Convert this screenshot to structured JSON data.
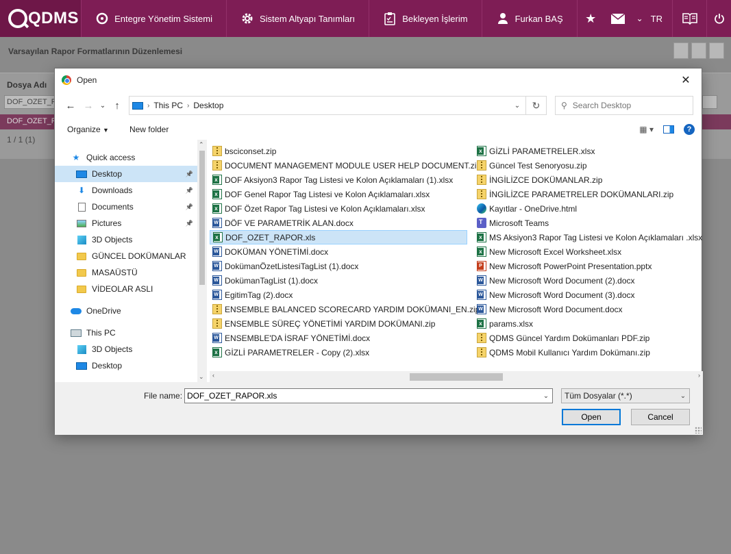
{
  "app": {
    "logo_text": "QDMS",
    "nav": [
      {
        "label": "Entegre Yönetim Sistemi",
        "icon": "q-circle-icon"
      },
      {
        "label": "Sistem Altyapı Tanımları",
        "icon": "gear-icon"
      },
      {
        "label": "Bekleyen İşlerim",
        "icon": "clipboard-icon"
      },
      {
        "label": "Furkan BAŞ",
        "icon": "user-icon"
      }
    ],
    "lang": "TR"
  },
  "background_page": {
    "title": "Varsayılan Rapor Formatlarının Düzenlemesi",
    "column_header": "Dosya Adı",
    "filter_value": "DOF_OZET_RA",
    "row_value": "DOF_OZET_RA",
    "pager": "1 / 1 (1)"
  },
  "dialog": {
    "title": "Open",
    "breadcrumb": [
      "This PC",
      "Desktop"
    ],
    "search_placeholder": "Search Desktop",
    "toolbar": {
      "organize": "Organize",
      "new_folder": "New folder"
    },
    "sidebar": [
      {
        "label": "Quick access",
        "icon": "star-icon",
        "level": 0,
        "pinned": false,
        "selected": false
      },
      {
        "label": "Desktop",
        "icon": "desktop-icon",
        "level": 1,
        "pinned": true,
        "selected": true
      },
      {
        "label": "Downloads",
        "icon": "download-icon",
        "level": 1,
        "pinned": true,
        "selected": false
      },
      {
        "label": "Documents",
        "icon": "documents-icon",
        "level": 1,
        "pinned": true,
        "selected": false
      },
      {
        "label": "Pictures",
        "icon": "pictures-icon",
        "level": 1,
        "pinned": true,
        "selected": false
      },
      {
        "label": "3D Objects",
        "icon": "cube-icon",
        "level": 1,
        "pinned": false,
        "selected": false
      },
      {
        "label": "GÜNCEL DOKÜMANLAR",
        "icon": "folder-icon",
        "level": 1,
        "pinned": false,
        "selected": false
      },
      {
        "label": "MASAÜSTÜ",
        "icon": "folder-icon",
        "level": 1,
        "pinned": false,
        "selected": false
      },
      {
        "label": "VİDEOLAR ASLI",
        "icon": "folder-icon",
        "level": 1,
        "pinned": false,
        "selected": false
      },
      {
        "label": "",
        "icon": "",
        "level": 0,
        "pinned": false,
        "selected": false
      },
      {
        "label": "OneDrive",
        "icon": "cloud-icon",
        "level": 0,
        "pinned": false,
        "selected": false
      },
      {
        "label": "",
        "icon": "",
        "level": 0,
        "pinned": false,
        "selected": false
      },
      {
        "label": "This PC",
        "icon": "pc-icon",
        "level": 0,
        "pinned": false,
        "selected": false
      },
      {
        "label": "3D Objects",
        "icon": "cube-icon",
        "level": 1,
        "pinned": false,
        "selected": false
      },
      {
        "label": "Desktop",
        "icon": "desktop-icon",
        "level": 1,
        "pinned": false,
        "selected": false
      }
    ],
    "files_col1": [
      {
        "name": "bsciconset.zip",
        "type": "zip"
      },
      {
        "name": "DOCUMENT MANAGEMENT MODULE USER HELP DOCUMENT.zip",
        "type": "zip"
      },
      {
        "name": "DOF Aksiyon3 Rapor Tag Listesi ve Kolon Açıklamaları (1).xlsx",
        "type": "xlsx"
      },
      {
        "name": "DOF Genel Rapor Tag Listesi ve Kolon Açıklamaları.xlsx",
        "type": "xlsx"
      },
      {
        "name": "DOF Özet Rapor Tag Listesi ve Kolon Açıklamaları.xlsx",
        "type": "xlsx"
      },
      {
        "name": "DÖF VE PARAMETRİK ALAN.docx",
        "type": "docx"
      },
      {
        "name": "DOF_OZET_RAPOR.xls",
        "type": "xlsx",
        "selected": true
      },
      {
        "name": "DOKÜMAN YÖNETİMİ.docx",
        "type": "docx"
      },
      {
        "name": "DokümanÖzetListesiTagList (1).docx",
        "type": "docx"
      },
      {
        "name": "DokümanTagList (1).docx",
        "type": "docx"
      },
      {
        "name": "EgitimTag (2).docx",
        "type": "docx"
      },
      {
        "name": "ENSEMBLE BALANCED SCORECARD YARDIM DOKÜMANI_EN.zip",
        "type": "zip"
      },
      {
        "name": "ENSEMBLE SÜREÇ YÖNETİMİ YARDIM DOKÜMANI.zip",
        "type": "zip"
      },
      {
        "name": "ENSEMBLE'DA İSRAF YÖNETİMİ.docx",
        "type": "docx"
      },
      {
        "name": "GİZLİ PARAMETRELER - Copy (2).xlsx",
        "type": "xlsx"
      }
    ],
    "files_col2": [
      {
        "name": "GİZLİ PARAMETRELER.xlsx",
        "type": "xlsx"
      },
      {
        "name": "Güncel Test Senoryosu.zip",
        "type": "zip"
      },
      {
        "name": "İNGİLİZCE DOKÜMANLAR.zip",
        "type": "zip"
      },
      {
        "name": "İNGİLİZCE PARAMETRELER DOKÜMANLARI.zip",
        "type": "zip"
      },
      {
        "name": "Kayıtlar - OneDrive.html",
        "type": "edge"
      },
      {
        "name": "Microsoft Teams",
        "type": "teams"
      },
      {
        "name": "MS Aksiyon3 Rapor Tag Listesi ve Kolon Açıklamaları .xlsx",
        "type": "xlsx"
      },
      {
        "name": "New Microsoft Excel Worksheet.xlsx",
        "type": "xlsx"
      },
      {
        "name": "New Microsoft PowerPoint Presentation.pptx",
        "type": "pptx"
      },
      {
        "name": "New Microsoft Word Document (2).docx",
        "type": "docx"
      },
      {
        "name": "New Microsoft Word Document (3).docx",
        "type": "docx"
      },
      {
        "name": "New Microsoft Word Document.docx",
        "type": "docx"
      },
      {
        "name": "params.xlsx",
        "type": "xlsx"
      },
      {
        "name": "QDMS Güncel Yardım Dokümanları PDF.zip",
        "type": "zip"
      },
      {
        "name": "QDMS Mobil Kullanıcı Yardım Dokümanı.zip",
        "type": "zip"
      }
    ],
    "file_name_label": "File name:",
    "file_name_value": "DOF_OZET_RAPOR.xls",
    "file_type": "Tüm Dosyalar (*.*)",
    "open_label": "Open",
    "cancel_label": "Cancel"
  }
}
